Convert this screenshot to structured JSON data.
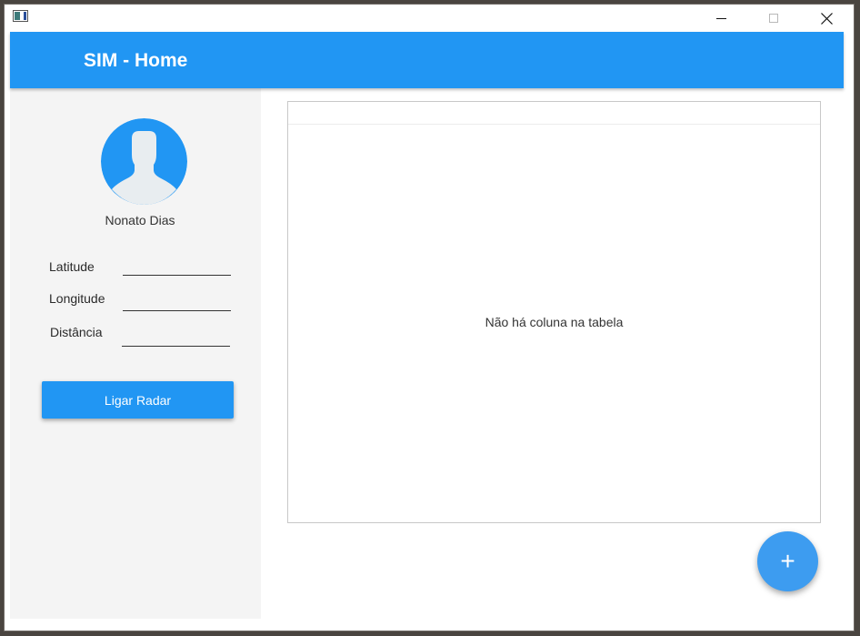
{
  "header": {
    "title": "SIM - Home",
    "color": "#2196f3"
  },
  "sidebar": {
    "username": "Nonato Dias",
    "fields": [
      {
        "label": "Latitude",
        "value": ""
      },
      {
        "label": "Longitude",
        "value": ""
      },
      {
        "label": "Distância",
        "value": ""
      }
    ],
    "radar_button": "Ligar Radar"
  },
  "table": {
    "empty_message": "Não há coluna na tabela"
  },
  "fab": {
    "label": "+"
  },
  "icons": {
    "app": "app-icon",
    "minimize": "minimize-icon",
    "maximize": "maximize-icon",
    "close": "close-icon",
    "avatar": "user-avatar-icon",
    "add": "plus-icon"
  }
}
